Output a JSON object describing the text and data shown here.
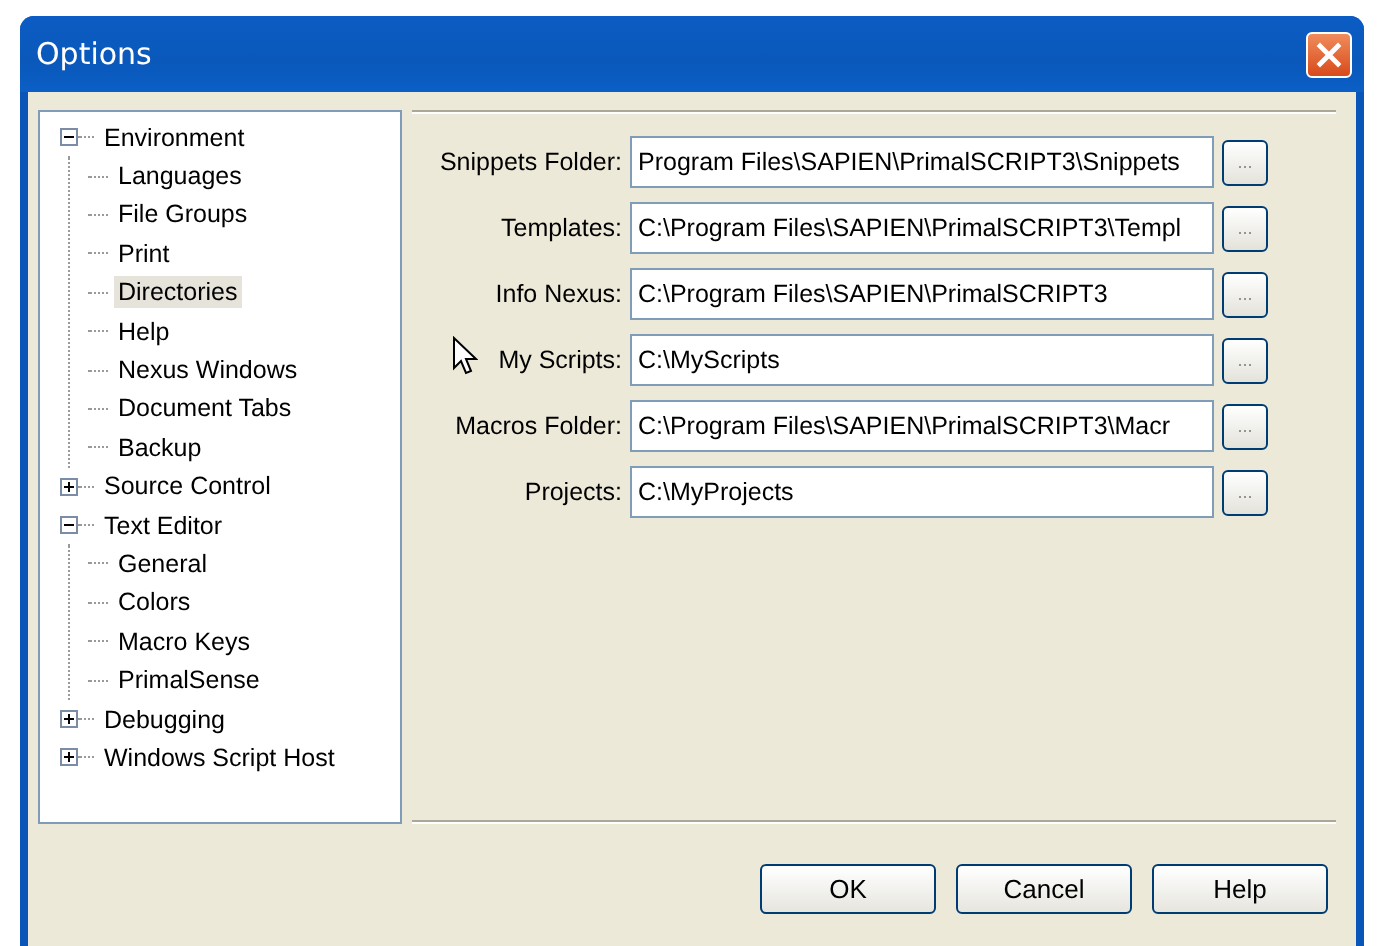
{
  "window": {
    "title": "Options"
  },
  "tree": [
    {
      "label": "Environment",
      "expanded": true,
      "selected": false,
      "children": [
        {
          "label": "Languages",
          "selected": false
        },
        {
          "label": "File Groups",
          "selected": false
        },
        {
          "label": "Print",
          "selected": false
        },
        {
          "label": "Directories",
          "selected": true
        },
        {
          "label": "Help",
          "selected": false
        },
        {
          "label": "Nexus Windows",
          "selected": false
        },
        {
          "label": "Document Tabs",
          "selected": false
        },
        {
          "label": "Backup",
          "selected": false
        }
      ]
    },
    {
      "label": "Source Control",
      "expanded": false,
      "selected": false
    },
    {
      "label": "Text Editor",
      "expanded": true,
      "selected": false,
      "children": [
        {
          "label": "General",
          "selected": false
        },
        {
          "label": "Colors",
          "selected": false
        },
        {
          "label": "Macro Keys",
          "selected": false
        },
        {
          "label": "PrimalSense",
          "selected": false
        }
      ]
    },
    {
      "label": "Debugging",
      "expanded": false,
      "selected": false
    },
    {
      "label": "Windows Script Host",
      "expanded": false,
      "selected": false
    }
  ],
  "directories": [
    {
      "label": "Snippets Folder:",
      "value": "Program Files\\SAPIEN\\PrimalSCRIPT3\\Snippets",
      "browse": "..."
    },
    {
      "label": "Templates:",
      "value": "C:\\Program Files\\SAPIEN\\PrimalSCRIPT3\\Templ",
      "browse": "..."
    },
    {
      "label": "Info Nexus:",
      "value": "C:\\Program Files\\SAPIEN\\PrimalSCRIPT3",
      "browse": "..."
    },
    {
      "label": "My Scripts:",
      "value": "C:\\MyScripts",
      "browse": "..."
    },
    {
      "label": "Macros Folder:",
      "value": "C:\\Program Files\\SAPIEN\\PrimalSCRIPT3\\Macr",
      "browse": "..."
    },
    {
      "label": "Projects:",
      "value": "C:\\MyProjects",
      "browse": "..."
    }
  ],
  "buttons": [
    "OK",
    "Cancel",
    "Help"
  ]
}
